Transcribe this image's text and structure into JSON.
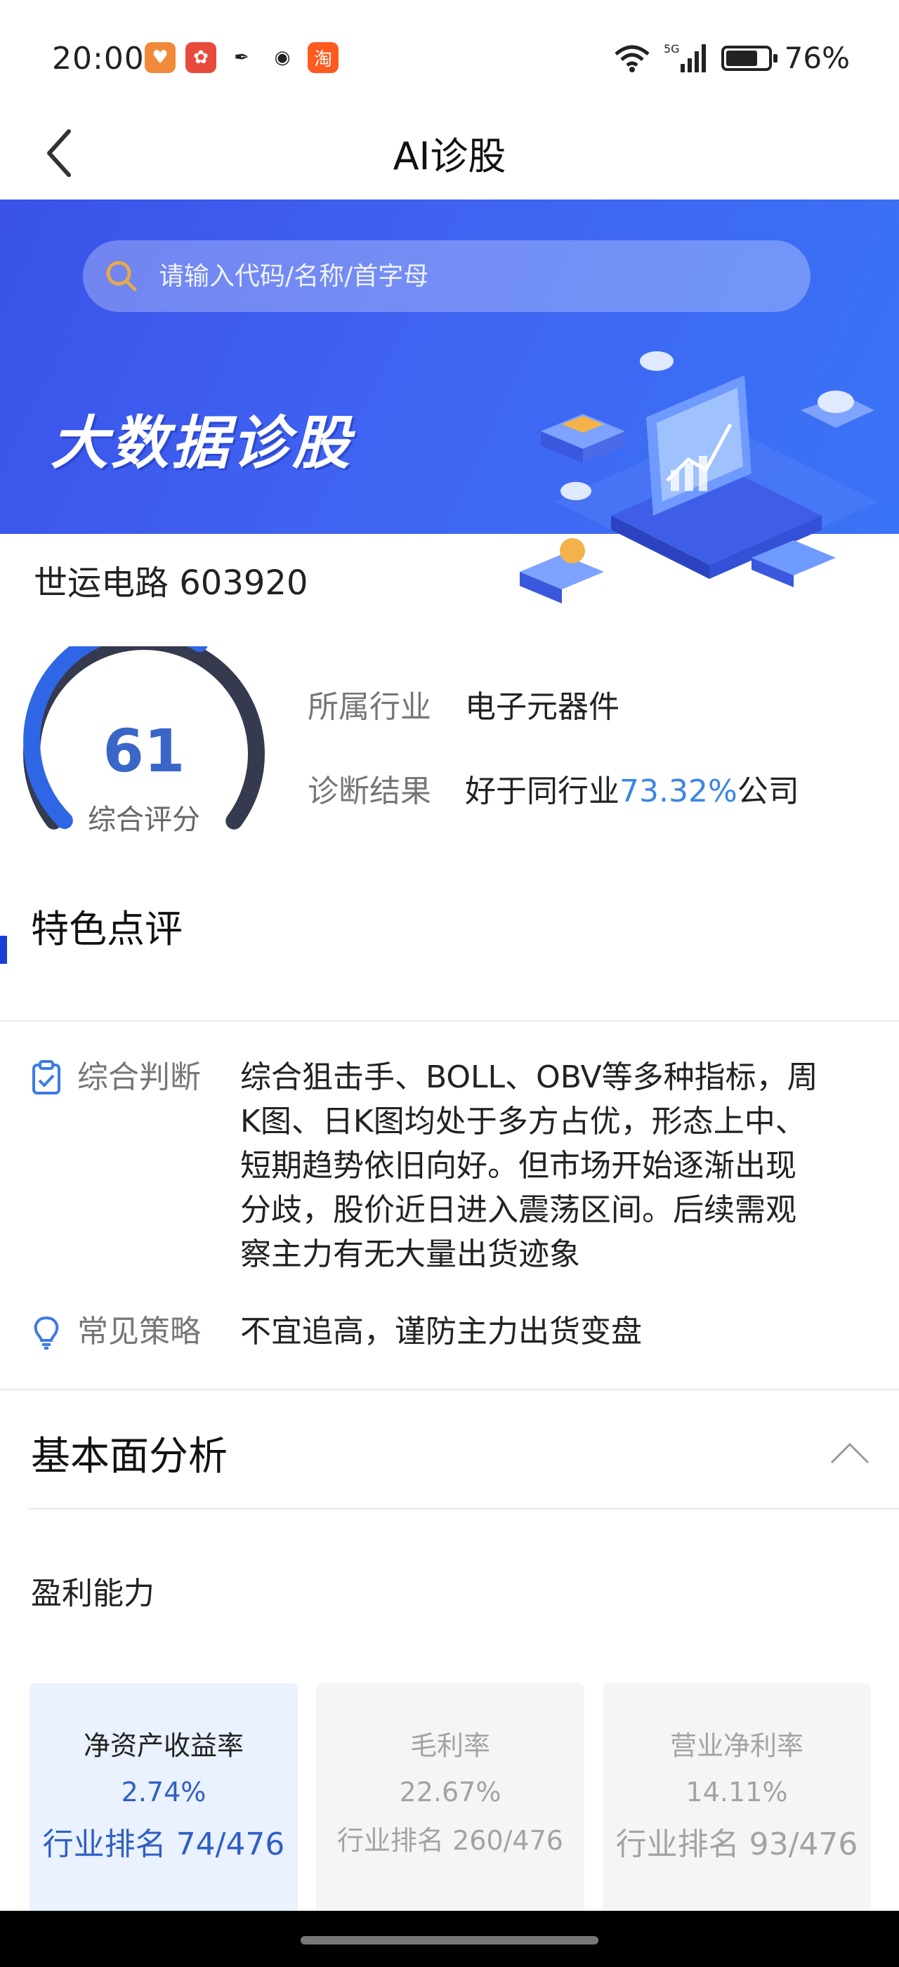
{
  "status_bar": {
    "time": "20:00",
    "network": "5G",
    "battery_text": "76%",
    "battery_level": 0.76,
    "app_icons": [
      {
        "name": "shield-app-icon",
        "color": "#f08a3a",
        "glyph": "♥"
      },
      {
        "name": "suning-app-icon",
        "color": "#e84a3c",
        "glyph": "✿"
      },
      {
        "name": "feather-app-icon",
        "color": "#222222",
        "glyph": "✒"
      },
      {
        "name": "wechat-app-icon",
        "color": "#222222",
        "glyph": "◉"
      },
      {
        "name": "taobao-app-icon",
        "color": "#ff5a1f",
        "glyph": "淘"
      }
    ]
  },
  "header": {
    "title": "AI诊股"
  },
  "banner": {
    "search_placeholder": "请输入代码/名称/首字母",
    "title": "大数据诊股"
  },
  "stock": {
    "name_code": "世运电路 603920"
  },
  "score": {
    "value": "61",
    "label": "综合评分",
    "fraction": 0.61
  },
  "info": {
    "industry_label": "所属行业",
    "industry_value": "电子元器件",
    "diagnosis_label": "诊断结果",
    "diagnosis_prefix": "好于同行业",
    "diagnosis_percent": "73.32%",
    "diagnosis_suffix": "公司"
  },
  "featured": {
    "title": "特色点评",
    "judgement_label": "综合判断",
    "judgement_text": "综合狙击手、BOLL、OBV等多种指标，周K图、日K图均处于多方占优，形态上中、短期趋势依旧向好。但市场开始逐渐出现分歧，股价近日进入震荡区间。后续需观察主力有无大量出货迹象",
    "strategy_label": "常见策略",
    "strategy_text": "不宜追高，谨防主力出货变盘"
  },
  "fundamentals": {
    "title": "基本面分析",
    "profit_title": "盈利能力",
    "cards": [
      {
        "label": "净资产收益率",
        "value": "2.74%",
        "rank": "行业排名 74/476"
      },
      {
        "label": "毛利率",
        "value": "22.67%",
        "rank": "行业排名 260/476"
      },
      {
        "label": "营业净利率",
        "value": "14.11%",
        "rank": "行业排名 93/476"
      }
    ]
  },
  "colors": {
    "brand_blue": "#3a5ce6",
    "accent": "#3b86e6",
    "gauge_dark": "#363a4f"
  }
}
